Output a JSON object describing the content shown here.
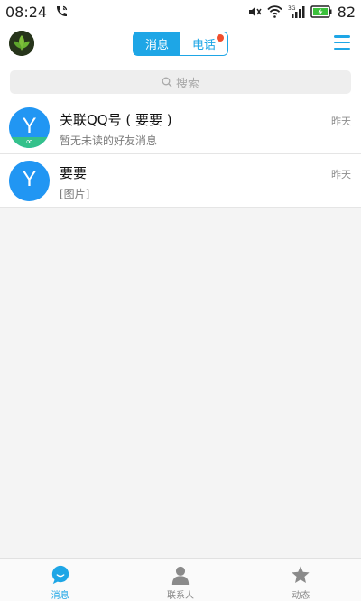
{
  "status_bar": {
    "time": "08:24",
    "battery": "82",
    "icons": [
      "phone-call-icon",
      "mute-icon",
      "wifi-icon",
      "signal-3g-icon",
      "battery-charging-icon"
    ]
  },
  "header": {
    "tabs": [
      {
        "label": "消息",
        "active": true
      },
      {
        "label": "电话",
        "active": false,
        "badge": true
      }
    ],
    "accent_color": "#1ea6e6",
    "badge_color": "#f04e2d"
  },
  "search": {
    "placeholder": "搜索"
  },
  "conversations": [
    {
      "title": "关联QQ号 ( 要要 )",
      "subtitle": "暂无未读的好友消息",
      "time": "昨天",
      "avatar_letter": "Y",
      "avatar_badge": "∞"
    },
    {
      "title": "要要",
      "subtitle": "[图片]",
      "time": "昨天",
      "avatar_letter": "Y"
    }
  ],
  "tab_bar": {
    "tabs": [
      {
        "label": "消息",
        "icon": "chat-bubble-icon",
        "active": true
      },
      {
        "label": "联系人",
        "icon": "person-icon",
        "active": false
      },
      {
        "label": "动态",
        "icon": "star-icon",
        "active": false
      }
    ]
  }
}
